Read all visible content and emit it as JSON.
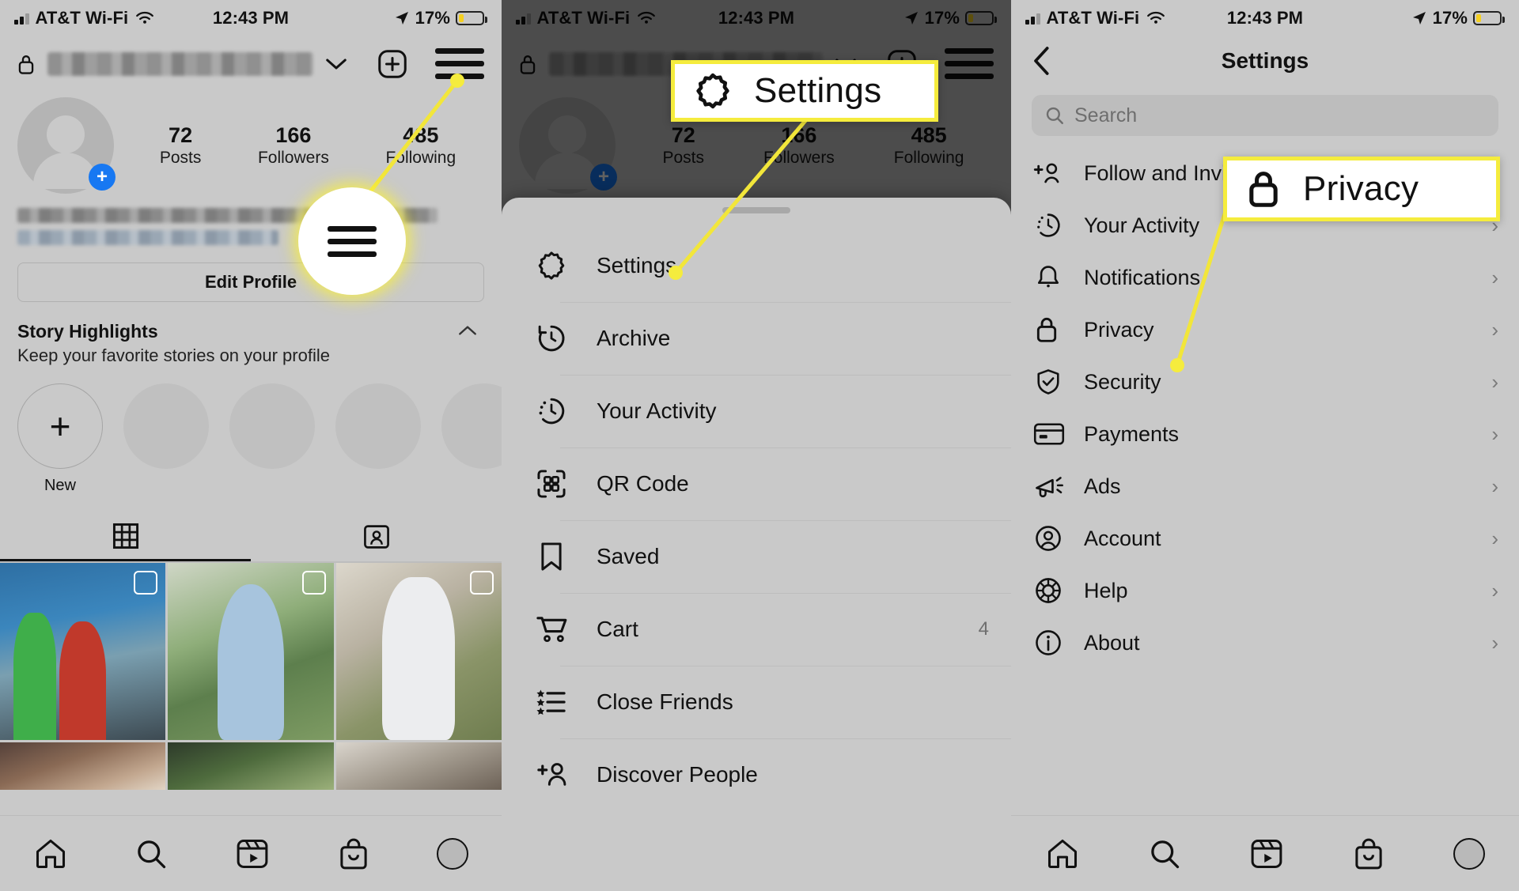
{
  "status_bar": {
    "carrier": "AT&T Wi-Fi",
    "time": "12:43 PM",
    "battery_percent": "17%",
    "wifi_icon": "wifi-icon",
    "location_icon": "location-arrow-icon",
    "signal_icon": "cellular-bars-icon",
    "battery_icon": "battery-icon"
  },
  "accent": {
    "highlight_yellow": "#f5ec3d",
    "instagram_blue": "#1778F2",
    "panel_bg": "#c9c9c9"
  },
  "left_panel": {
    "lock_icon": "lock-icon",
    "username_chevron_icon": "chevron-down-icon",
    "add_icon": "plus-square-icon",
    "menu_icon": "hamburger-menu-icon",
    "avatar_icon": "avatar-placeholder",
    "add_story_icon": "plus-circle-icon",
    "stats": [
      {
        "number": "72",
        "label": "Posts"
      },
      {
        "number": "166",
        "label": "Followers"
      },
      {
        "number": "485",
        "label": "Following"
      }
    ],
    "edit_profile_label": "Edit Profile",
    "highlights": {
      "title": "Story Highlights",
      "subtitle": "Keep your favorite stories on your profile",
      "collapse_icon": "chevron-up-icon",
      "new_label": "New",
      "new_icon": "plus-icon"
    },
    "tabs": [
      {
        "name": "grid",
        "icon": "grid-icon",
        "active": true
      },
      {
        "name": "tagged",
        "icon": "tagged-person-icon",
        "active": false
      }
    ],
    "bottom_nav": [
      {
        "name": "home",
        "icon": "home-icon"
      },
      {
        "name": "search",
        "icon": "search-icon"
      },
      {
        "name": "reels",
        "icon": "reels-icon"
      },
      {
        "name": "shop",
        "icon": "shop-bag-icon"
      },
      {
        "name": "profile",
        "icon": "profile-avatar-icon"
      }
    ]
  },
  "middle_panel": {
    "sheet_grabber": "drag-handle",
    "menu_items": [
      {
        "label": "Settings",
        "icon": "gear-icon",
        "badge": ""
      },
      {
        "label": "Archive",
        "icon": "archive-clock-icon",
        "badge": ""
      },
      {
        "label": "Your Activity",
        "icon": "activity-clock-icon",
        "badge": ""
      },
      {
        "label": "QR Code",
        "icon": "qr-code-icon",
        "badge": ""
      },
      {
        "label": "Saved",
        "icon": "bookmark-icon",
        "badge": ""
      },
      {
        "label": "Cart",
        "icon": "shopping-cart-icon",
        "badge": "4"
      },
      {
        "label": "Close Friends",
        "icon": "close-friends-list-icon",
        "badge": ""
      },
      {
        "label": "Discover People",
        "icon": "discover-people-icon",
        "badge": ""
      }
    ]
  },
  "right_panel": {
    "back_icon": "chevron-left-icon",
    "title": "Settings",
    "search": {
      "placeholder": "Search",
      "icon": "search-icon"
    },
    "items": [
      {
        "label": "Follow and Invite Friends",
        "icon": "follow-invite-icon",
        "chevron": "›"
      },
      {
        "label": "Your Activity",
        "icon": "activity-clock-icon",
        "chevron": "›"
      },
      {
        "label": "Notifications",
        "icon": "bell-icon",
        "chevron": "›"
      },
      {
        "label": "Privacy",
        "icon": "lock-icon",
        "chevron": "›"
      },
      {
        "label": "Security",
        "icon": "shield-check-icon",
        "chevron": "›"
      },
      {
        "label": "Payments",
        "icon": "credit-card-icon",
        "chevron": "›"
      },
      {
        "label": "Ads",
        "icon": "megaphone-icon",
        "chevron": "›"
      },
      {
        "label": "Account",
        "icon": "account-circle-icon",
        "chevron": "›"
      },
      {
        "label": "Help",
        "icon": "help-circle-icon",
        "chevron": "›"
      },
      {
        "label": "About",
        "icon": "info-circle-icon",
        "chevron": "›"
      }
    ],
    "bottom_nav": [
      {
        "name": "home",
        "icon": "home-icon"
      },
      {
        "name": "search",
        "icon": "search-icon"
      },
      {
        "name": "reels",
        "icon": "reels-icon"
      },
      {
        "name": "shop",
        "icon": "shop-bag-icon"
      },
      {
        "name": "profile",
        "icon": "profile-avatar-icon"
      }
    ]
  },
  "callouts": [
    {
      "id": "menu",
      "label": "",
      "icon": "hamburger-menu-icon"
    },
    {
      "id": "settings",
      "label": "Settings",
      "icon": "gear-icon"
    },
    {
      "id": "privacy",
      "label": "Privacy",
      "icon": "lock-icon"
    }
  ]
}
